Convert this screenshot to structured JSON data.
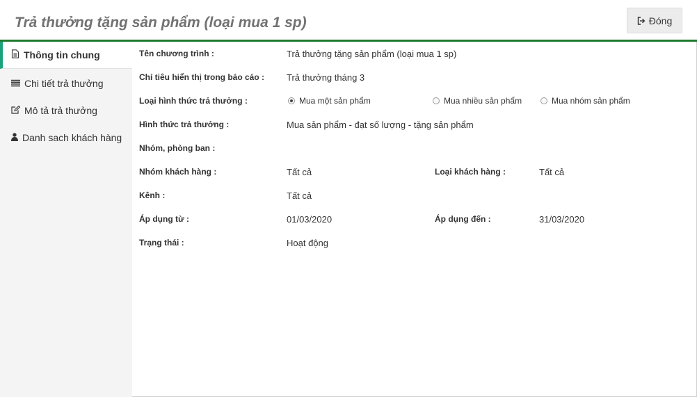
{
  "header": {
    "title": "Trả thưởng tặng sản phẩm (loại mua 1 sp)",
    "close_label": "Đóng"
  },
  "sidebar": {
    "items": [
      {
        "label": "Thông tin chung",
        "icon": "document-icon",
        "active": true
      },
      {
        "label": "Chi tiết trả thưởng",
        "icon": "list-icon",
        "active": false
      },
      {
        "label": "Mô tả trả thưởng",
        "icon": "edit-icon",
        "active": false
      },
      {
        "label": "Danh sach khách hàng",
        "icon": "user-icon",
        "active": false
      }
    ]
  },
  "form": {
    "program_name_label": "Tên chương trình :",
    "program_name_value": "Trả thưởng tặng sản phẩm (loại mua 1 sp)",
    "report_indicator_label": "Chỉ tiêu hiển thị trong báo cáo :",
    "report_indicator_value": "Trả thưởng tháng 3",
    "reward_type_label": "Loại hình thức trả thưởng :",
    "reward_type_options": [
      {
        "label": "Mua một sản phẩm",
        "checked": true
      },
      {
        "label": "Mua nhiều sản phẩm",
        "checked": false
      },
      {
        "label": "Mua nhóm sản phẩm",
        "checked": false
      }
    ],
    "reward_form_label": "Hình thức trả thưởng :",
    "reward_form_value": "Mua sản phẩm - đạt số lượng - tặng sản phẩm",
    "department_label": "Nhóm, phòng ban :",
    "department_value": "",
    "customer_group_label": "Nhóm khách hàng :",
    "customer_group_value": "Tất cả",
    "customer_type_label": "Loại khách hàng :",
    "customer_type_value": "Tất cả",
    "channel_label": "Kênh :",
    "channel_value": "Tất cả",
    "apply_from_label": "Áp dụng từ :",
    "apply_from_value": "01/03/2020",
    "apply_to_label": "Áp dụng đến :",
    "apply_to_value": "31/03/2020",
    "status_label": "Trạng thái :",
    "status_value": "Hoạt động"
  },
  "colors": {
    "accent_green": "#1e7a2f",
    "active_tab_border": "#1aa37a",
    "sidebar_bg": "#f4f4f4"
  }
}
